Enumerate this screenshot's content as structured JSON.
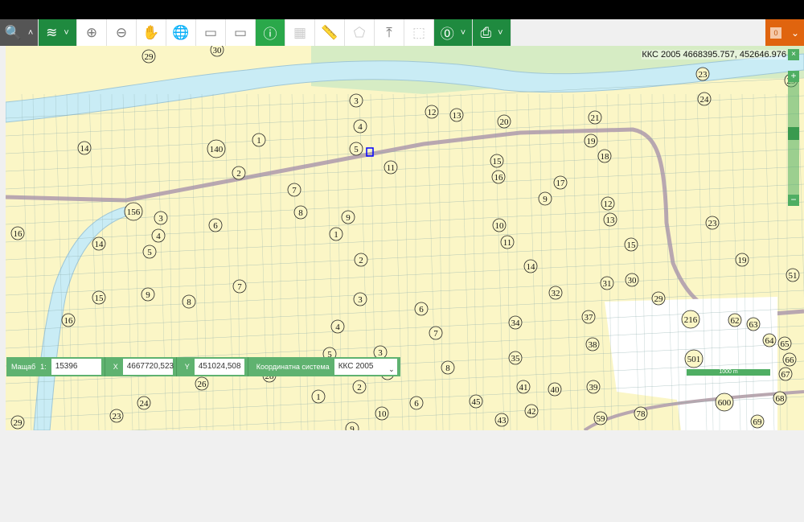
{
  "toolbar": {
    "buttons": [
      {
        "icon": "search-icon",
        "glyph": "🔍"
      },
      {
        "icon": "layers-icon",
        "glyph": "≋"
      },
      {
        "icon": "zoom-in-icon",
        "glyph": "⊕"
      },
      {
        "icon": "zoom-out-icon",
        "glyph": "⊖"
      },
      {
        "icon": "pan-hand-icon",
        "glyph": "✋"
      },
      {
        "icon": "globe-icon",
        "glyph": "🌐"
      },
      {
        "icon": "zoom-box-in-icon",
        "glyph": "▭"
      },
      {
        "icon": "zoom-box-out-icon",
        "glyph": "▭"
      },
      {
        "icon": "info-icon",
        "glyph": "ⓘ"
      },
      {
        "icon": "measure-area-icon",
        "glyph": "▦"
      },
      {
        "icon": "ruler-icon",
        "glyph": "📏"
      },
      {
        "icon": "polygon-icon",
        "glyph": "⬠"
      },
      {
        "icon": "upload-icon",
        "glyph": "⤒"
      },
      {
        "icon": "select-icon",
        "glyph": "⬚"
      },
      {
        "icon": "layer-info-icon",
        "glyph": "⓪"
      },
      {
        "icon": "print-icon",
        "glyph": "⎙"
      }
    ]
  },
  "cart": {
    "count": "0"
  },
  "map": {
    "coordinates_readout": "ККС 2005 4668395.757, 452646.976",
    "scale_label": "1000 m",
    "parcel_labels": [
      "29",
      "30",
      "3",
      "4",
      "5",
      "12",
      "13",
      "20",
      "21",
      "23",
      "24",
      "29",
      "14",
      "140",
      "1",
      "11",
      "19",
      "18",
      "15",
      "16",
      "17",
      "2",
      "7",
      "9",
      "12",
      "13",
      "8",
      "9",
      "156",
      "3",
      "10",
      "11",
      "15",
      "23",
      "16",
      "6",
      "4",
      "14",
      "5",
      "1",
      "2",
      "19",
      "14",
      "51",
      "7",
      "31",
      "30",
      "32",
      "9",
      "15",
      "8",
      "3",
      "29",
      "6",
      "16",
      "216",
      "62",
      "63",
      "37",
      "34",
      "4",
      "7",
      "38",
      "64",
      "65",
      "501",
      "5",
      "3",
      "35",
      "66",
      "8",
      "4",
      "67",
      "28",
      "26",
      "41",
      "40",
      "39",
      "2",
      "1",
      "68",
      "600",
      "24",
      "45",
      "6",
      "42",
      "10",
      "23",
      "78",
      "29",
      "43",
      "59",
      "69",
      "9"
    ],
    "colors": {
      "land": "#fbf6c6",
      "river": "#c9ecf5",
      "road": "#b9a7b0",
      "green": "#d6ecc4",
      "accent": "#1f8a3f"
    }
  },
  "bottom": {
    "scale_label": "Мащаб",
    "scale_prefix": "1:",
    "scale_value": "15396",
    "x_label": "X",
    "x_value": "4667720,523",
    "y_label": "Y",
    "y_value": "451024,508",
    "crs_label": "Координатна система",
    "crs_value": "ККС 2005"
  }
}
